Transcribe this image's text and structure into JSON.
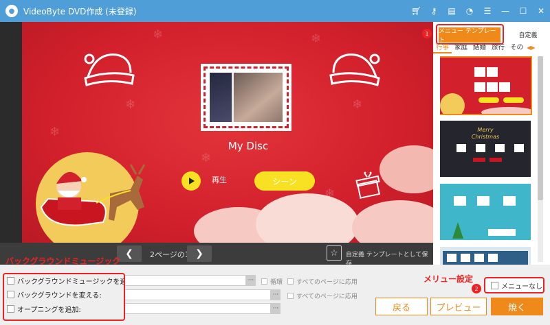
{
  "app": {
    "title": "VideoByte DVD作成 (未登録)"
  },
  "titlebar_icons": [
    "cart-icon",
    "key-icon",
    "register-icon",
    "chat-icon",
    "menu-icon",
    "minimize-icon",
    "maximize-icon",
    "close-icon"
  ],
  "preview": {
    "disc_title": "My Disc",
    "play_label": "再生",
    "scene_button": "シーン",
    "colors": {
      "background": "#d2202c",
      "button": "#f8e023"
    }
  },
  "pager": {
    "page_label": "2ページの1",
    "save_template": "自定義 テンプレートとして保存"
  },
  "right_panel": {
    "tab_menu_template": "メニュー テンプレート",
    "tab_custom": "自定義",
    "categories": [
      "行事",
      "家庭",
      "結婚",
      "旅行",
      "その"
    ],
    "active_category": "行事"
  },
  "bottom": {
    "options": [
      {
        "label": "バックグラウンドミュージックを追加:"
      },
      {
        "label": "バックグラウンドを変える:"
      },
      {
        "label": "オープニングを追加:"
      }
    ],
    "loop_label": "循環",
    "apply_all_1": "すべてのページに応用",
    "apply_all_2": "すべてのページに応用",
    "menu_none": "メニューなし",
    "back_button": "戻る",
    "preview_button": "プレビュー",
    "burn_button": "焼く",
    "accent_color": "#ef8a1a"
  },
  "annotations": {
    "bg_music": "バックグラウンドミュージック",
    "menu_settings": "メリュー設定",
    "badge_1": "1",
    "badge_2": "2",
    "color": "#e22222"
  }
}
